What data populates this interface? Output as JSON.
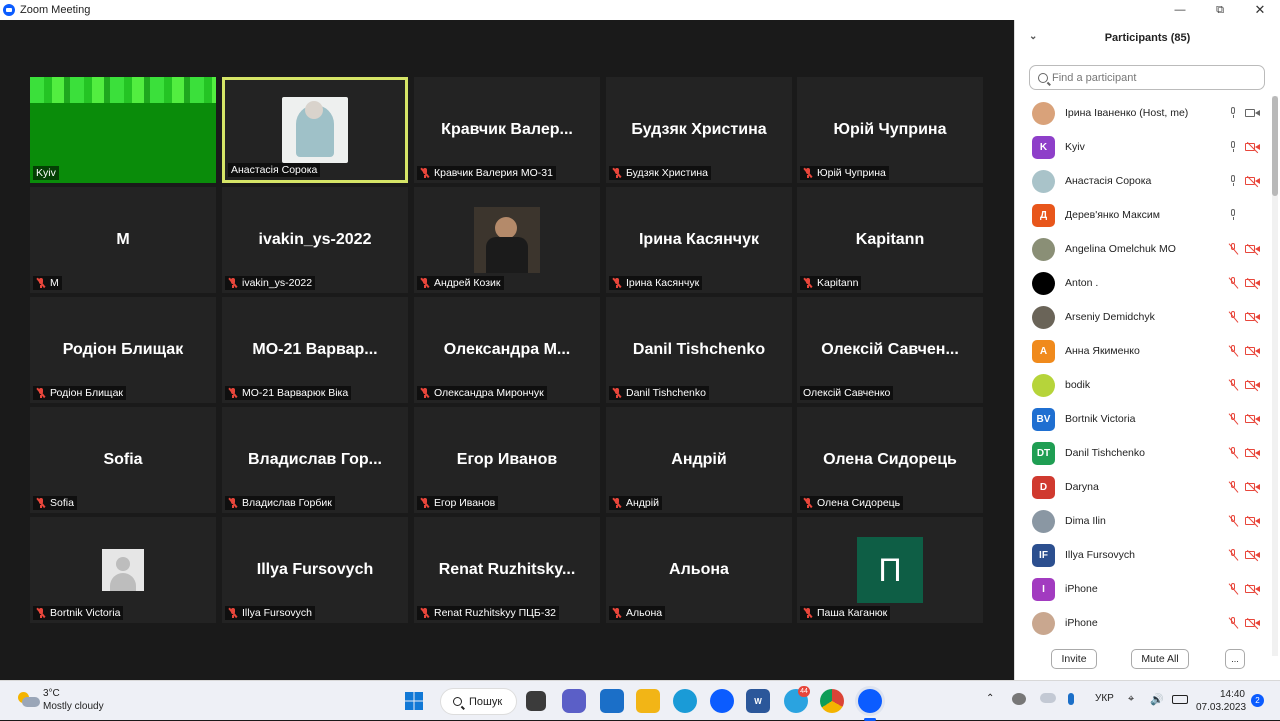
{
  "window": {
    "title": "Zoom Meeting"
  },
  "tiles": [
    {
      "kind": "video-green",
      "display": "",
      "label": "Kyiv",
      "muted": false,
      "active": false
    },
    {
      "kind": "avatar",
      "display": "",
      "label": "Анастасія Сорока",
      "muted": false,
      "active": true
    },
    {
      "kind": "name",
      "display": "Кравчик Валер...",
      "label": "Кравчик Валерия МО-31",
      "muted": true,
      "active": false
    },
    {
      "kind": "name",
      "display": "Будзяк Христина",
      "label": "Будзяк Христина",
      "muted": true,
      "active": false
    },
    {
      "kind": "name",
      "display": "Юрій Чуприна",
      "label": "Юрій Чуприна",
      "muted": true,
      "active": false
    },
    {
      "kind": "name",
      "display": "M",
      "label": "M",
      "muted": true,
      "active": false
    },
    {
      "kind": "name",
      "display": "ivakin_ys-2022",
      "label": "ivakin_ys-2022",
      "muted": true,
      "active": false
    },
    {
      "kind": "photo",
      "display": "",
      "label": "Андрей Козик",
      "muted": true,
      "active": false
    },
    {
      "kind": "name",
      "display": "Ірина Касянчук",
      "label": "Ірина Касянчук",
      "muted": true,
      "active": false
    },
    {
      "kind": "name",
      "display": "Kapitann",
      "label": "Kapitann",
      "muted": true,
      "active": false
    },
    {
      "kind": "name",
      "display": "Родіон Блищак",
      "label": "Родіон Блищак",
      "muted": true,
      "active": false
    },
    {
      "kind": "name",
      "display": "МО-21 Варвар...",
      "label": "МО-21 Варварюк Віка",
      "muted": true,
      "active": false
    },
    {
      "kind": "name",
      "display": "Олександра М...",
      "label": "Олександра Мирончук",
      "muted": true,
      "active": false
    },
    {
      "kind": "name",
      "display": "Danil Tishchenko",
      "label": "Danil Tishchenko",
      "muted": true,
      "active": false
    },
    {
      "kind": "name",
      "display": "Олексій Савчен...",
      "label": "Олексій Савченко",
      "muted": false,
      "active": false
    },
    {
      "kind": "name",
      "display": "Sofia",
      "label": "Sofia",
      "muted": true,
      "active": false
    },
    {
      "kind": "name",
      "display": "Владислав Гор...",
      "label": "Владислав Горбик",
      "muted": true,
      "active": false
    },
    {
      "kind": "name",
      "display": "Егор Иванов",
      "label": "Егор Иванов",
      "muted": true,
      "active": false
    },
    {
      "kind": "name",
      "display": "Андрій",
      "label": "Андрій",
      "muted": true,
      "active": false
    },
    {
      "kind": "name",
      "display": "Олена Сидорець",
      "label": "Олена Сидорець",
      "muted": true,
      "active": false
    },
    {
      "kind": "default-avatar",
      "display": "",
      "label": "Bortnik Victoria",
      "muted": true,
      "active": false
    },
    {
      "kind": "name",
      "display": "Illya Fursovych",
      "label": "Illya Fursovych",
      "muted": true,
      "active": false
    },
    {
      "kind": "name",
      "display": "Renat Ruzhitsky...",
      "label": "Renat Ruzhitskyy ПЦБ-32",
      "muted": true,
      "active": false
    },
    {
      "kind": "name",
      "display": "Альона",
      "label": "Альона",
      "muted": true,
      "active": false
    },
    {
      "kind": "letter",
      "display": "П",
      "label": "Паша Каганюк",
      "muted": true,
      "active": false
    }
  ],
  "panel": {
    "title": "Participants (85)",
    "search_placeholder": "Find a participant",
    "invite_label": "Invite",
    "mute_all_label": "Mute All",
    "more_label": "...",
    "participants": [
      {
        "name": "Ірина Іваненко (Host, me)",
        "initials": "",
        "color": "#d9a27a",
        "mic": "on",
        "cam": "on"
      },
      {
        "name": "Kyiv",
        "initials": "K",
        "color": "#8e3fc9",
        "mic": "on",
        "cam": "off"
      },
      {
        "name": "Анастасія Сорока",
        "initials": "",
        "color": "#a9c3c9",
        "mic": "on",
        "cam": "off"
      },
      {
        "name": "Дерев'янко Максим",
        "initials": "Д",
        "color": "#e8561b",
        "mic": "on",
        "cam": "none"
      },
      {
        "name": "Angelina Omelchuk МО",
        "initials": "",
        "color": "#8a8f76",
        "mic": "off",
        "cam": "off"
      },
      {
        "name": "Anton .",
        "initials": "",
        "color": "#000000",
        "mic": "off",
        "cam": "off"
      },
      {
        "name": "Arseniy Demidchyk",
        "initials": "",
        "color": "#6a6458",
        "mic": "off",
        "cam": "off"
      },
      {
        "name": "Анна Якименко",
        "initials": "А",
        "color": "#f08a1c",
        "mic": "off",
        "cam": "off"
      },
      {
        "name": "bodik",
        "initials": "",
        "color": "#b6d43a",
        "mic": "off",
        "cam": "off"
      },
      {
        "name": "Bortnik Victoria",
        "initials": "BV",
        "color": "#1f6fd1",
        "mic": "off",
        "cam": "off"
      },
      {
        "name": "Danil Tishchenko",
        "initials": "DT",
        "color": "#1f9e53",
        "mic": "off",
        "cam": "off"
      },
      {
        "name": "Daryna",
        "initials": "D",
        "color": "#d03a2f",
        "mic": "off",
        "cam": "off"
      },
      {
        "name": "Dima Ilin",
        "initials": "",
        "color": "#8a97a3",
        "mic": "off",
        "cam": "off"
      },
      {
        "name": "Illya Fursovych",
        "initials": "IF",
        "color": "#2c4f8f",
        "mic": "off",
        "cam": "off"
      },
      {
        "name": "iPhone",
        "initials": "I",
        "color": "#a23bc0",
        "mic": "off",
        "cam": "off"
      },
      {
        "name": "iPhone",
        "initials": "",
        "color": "#c9a78f",
        "mic": "off",
        "cam": "off"
      }
    ]
  },
  "taskbar": {
    "weather_temp": "3°C",
    "weather_desc": "Mostly cloudy",
    "search_label": "Пошук",
    "telegram_badge": "44",
    "language": "УКР",
    "time": "14:40",
    "date": "07.03.2023",
    "notifications": "2"
  },
  "colors": {
    "accent": "#0b5cff",
    "active_speaker_border": "#d6e567",
    "muted_red": "#e8463b",
    "letter_tile_bg": "#0e5e45"
  }
}
